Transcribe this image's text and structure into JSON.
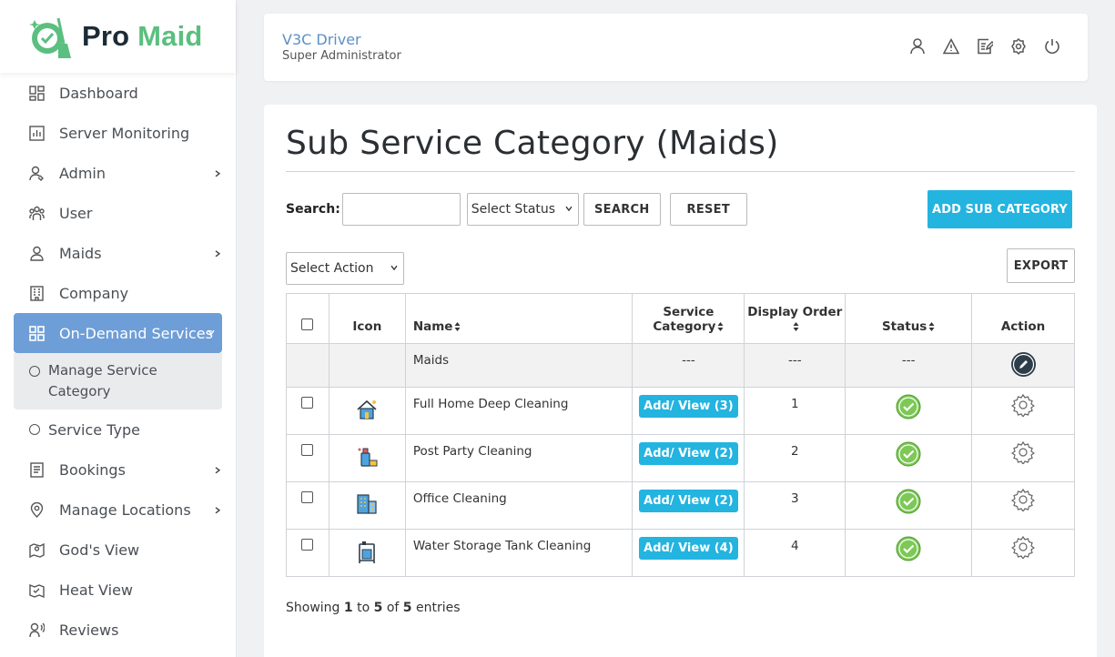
{
  "brand": {
    "pro": "Pro",
    "maid": "Maid"
  },
  "sidebar": {
    "items": [
      {
        "label": "Dashboard",
        "icon": "dashboard-icon"
      },
      {
        "label": "Server Monitoring",
        "icon": "chart-icon"
      },
      {
        "label": "Admin",
        "icon": "admin-icon"
      },
      {
        "label": "User",
        "icon": "users-icon"
      },
      {
        "label": "Maids",
        "icon": "maid-icon"
      },
      {
        "label": "Company",
        "icon": "building-icon"
      },
      {
        "label": "On-Demand Services",
        "icon": "grid-icon"
      },
      {
        "label": "Service Type",
        "icon": "circle-icon"
      },
      {
        "label": "Bookings",
        "icon": "bookings-icon"
      },
      {
        "label": "Manage Locations",
        "icon": "location-pin-icon"
      },
      {
        "label": "God's View",
        "icon": "map-pin-icon"
      },
      {
        "label": "Heat View",
        "icon": "heat-map-icon"
      },
      {
        "label": "Reviews",
        "icon": "reviews-icon"
      }
    ],
    "sub_active": "Manage Service Category"
  },
  "header": {
    "user_name": "V3C Driver",
    "user_role": "Super Administrator"
  },
  "page": {
    "title": "Sub Service Category (Maids)",
    "search_label": "Search:",
    "search_value": "",
    "status_select": "Select Status",
    "search_button": "SEARCH",
    "reset_button": "RESET",
    "add_button": "ADD SUB CATEGORY",
    "action_select": "Select Action",
    "export_button": "EXPORT"
  },
  "table": {
    "headers": {
      "icon": "Icon",
      "name": "Name",
      "service_category_1": "Service",
      "service_category_2": "Category",
      "display_order_1": "Display Order",
      "status": "Status",
      "action": "Action"
    },
    "parent": {
      "name": "Maids",
      "category": "---",
      "order": "---",
      "status": "---"
    },
    "rows": [
      {
        "name": "Full Home Deep Cleaning",
        "category": "Add/ View (3)",
        "order": "1"
      },
      {
        "name": "Post Party Cleaning",
        "category": "Add/ View (2)",
        "order": "2"
      },
      {
        "name": "Office Cleaning",
        "category": "Add/ View (2)",
        "order": "3"
      },
      {
        "name": "Water Storage Tank Cleaning",
        "category": "Add/ View (4)",
        "order": "4"
      }
    ]
  },
  "footer": {
    "showing_prefix": "Showing",
    "from": "1",
    "to_word": "to",
    "to": "5",
    "of_word": "of",
    "total": "5",
    "entries_word": "entries"
  },
  "colors": {
    "accent": "#23b4e0",
    "sidebar_active": "#6e9ed7",
    "brand_green": "#5bbf7f",
    "status_green": "#7dc856"
  }
}
